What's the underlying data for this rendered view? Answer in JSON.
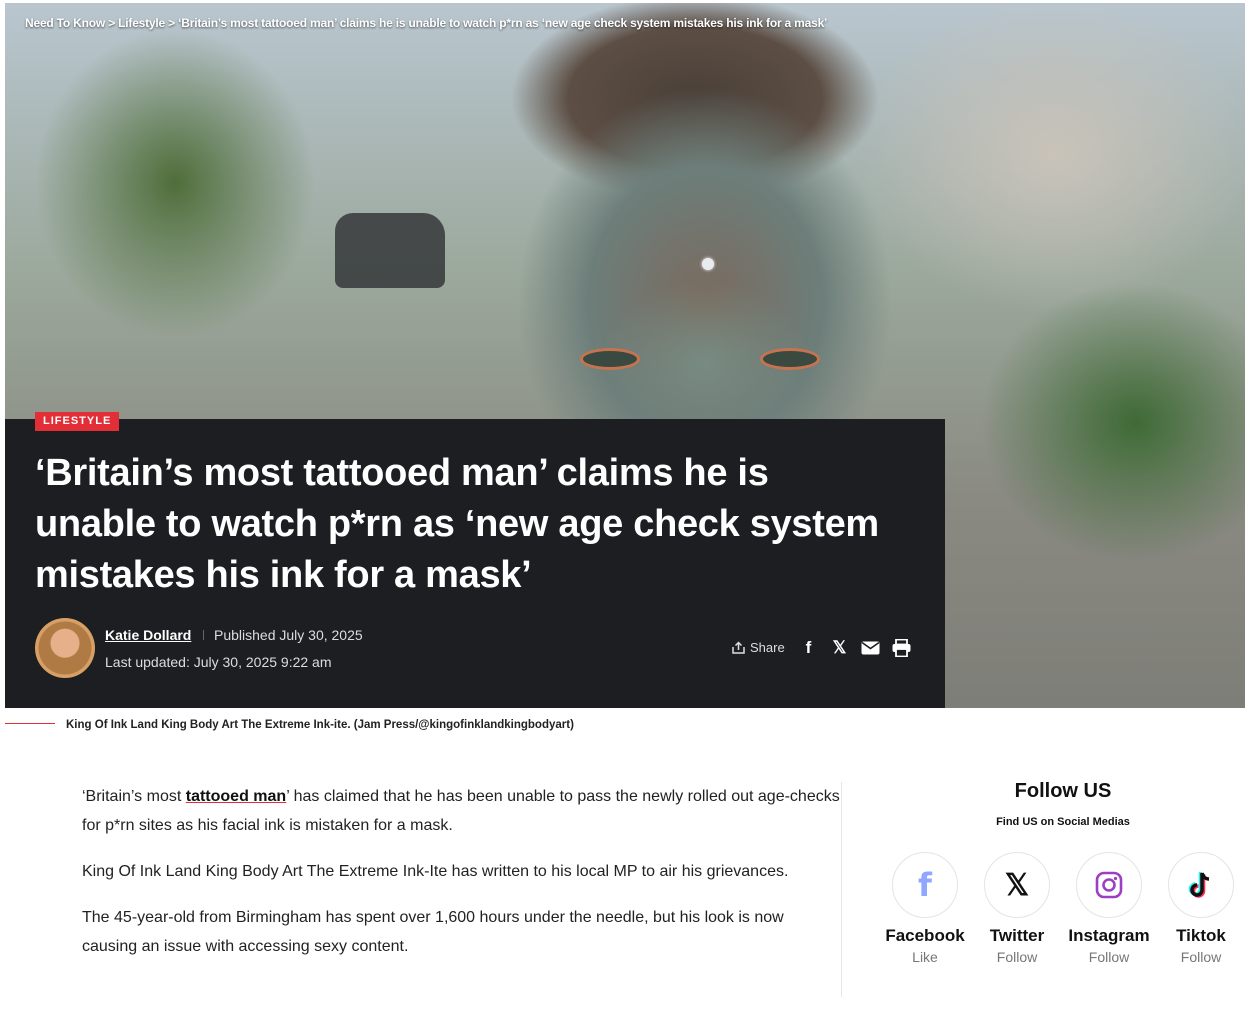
{
  "breadcrumb": {
    "items": [
      "Need To Know",
      "Lifestyle"
    ],
    "separator": ">",
    "current": "‘Britain’s most tattooed man’ claims he is unable to watch p*rn as ‘new age check system mistakes his ink for a mask’"
  },
  "article": {
    "category": "LIFESTYLE",
    "title": "‘Britain’s most tattooed man’ claims he is unable to watch p*rn as ‘new age check system mistakes his ink for a mask’",
    "author": "Katie Dollard",
    "published": "Published July 30, 2025",
    "updated": "Last updated: July 30, 2025 9:22 am",
    "share_label": "Share",
    "caption": "King Of Ink Land King Body Art The Extreme Ink-ite. (Jam Press/@kingofinklandkingbodyart)",
    "para1_pre": "‘Britain’s most ",
    "para1_link": "tattooed man",
    "para1_post": "’ has claimed that he has been unable to pass the newly rolled out age-checks for p*rn sites as his facial ink is mistaken for a mask.",
    "para2": "King Of Ink Land King Body Art The Extreme Ink-Ite has written to his local MP to air his grievances.",
    "para3": "The 45-year-old from Birmingham has spent over 1,600 hours under the needle, but his look is now causing an issue with accessing sexy content."
  },
  "share_icons": [
    "facebook-icon",
    "x-icon",
    "mail-icon",
    "print-icon"
  ],
  "sidebar": {
    "title": "Follow US",
    "subtitle": "Find US on Social Medias",
    "socials": [
      {
        "name": "Facebook",
        "action": "Like",
        "icon": "facebook-icon",
        "color": "#8fa8ff"
      },
      {
        "name": "Twitter",
        "action": "Follow",
        "icon": "x-icon",
        "color": "#111111"
      },
      {
        "name": "Instagram",
        "action": "Follow",
        "icon": "instagram-icon",
        "color": "#9b3fc4"
      },
      {
        "name": "Tiktok",
        "action": "Follow",
        "icon": "tiktok-icon",
        "color": "#111111"
      }
    ]
  },
  "colors": {
    "accent": "#e22e37",
    "panel": "#1c1e22"
  }
}
